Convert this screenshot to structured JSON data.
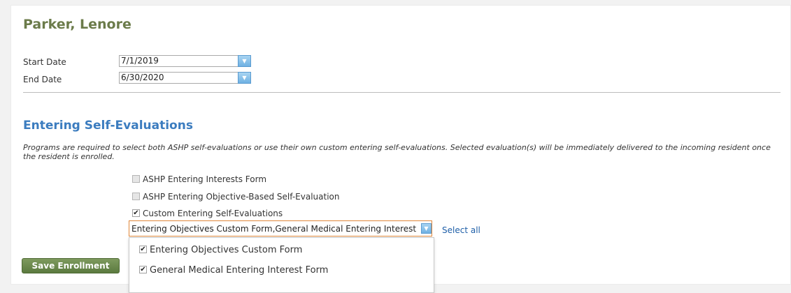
{
  "header": {
    "name": "Parker, Lenore"
  },
  "dates": {
    "start_label": "Start Date",
    "start_value": "7/1/2019",
    "end_label": "End Date",
    "end_value": "6/30/2020"
  },
  "section": {
    "title": "Entering Self-Evaluations",
    "description": "Programs are required to select both ASHP self-evaluations or use their own custom entering self-evaluations. Selected evaluation(s) will be immediately delivered to the incoming resident once the resident is enrolled."
  },
  "options": [
    {
      "label": "ASHP Entering Interests Form",
      "checked": false
    },
    {
      "label": "ASHP Entering Objective-Based Self-Evaluation",
      "checked": false
    },
    {
      "label": "Custom Entering Self-Evaluations",
      "checked": true
    }
  ],
  "custom_select": {
    "value": "Entering Objectives Custom Form,General Medical Entering Interest Form",
    "select_all_label": "Select all",
    "items": [
      {
        "label": "Entering Objectives Custom Form",
        "checked": true
      },
      {
        "label": "General Medical Entering Interest Form",
        "checked": true
      }
    ]
  },
  "actions": {
    "save_label": "Save Enrollment"
  },
  "colors": {
    "title": "#6b7b4a",
    "section": "#3b7cbf",
    "link": "#1f5fa8",
    "save_button": "#5b7a3f",
    "focus_border": "#e0873a"
  }
}
